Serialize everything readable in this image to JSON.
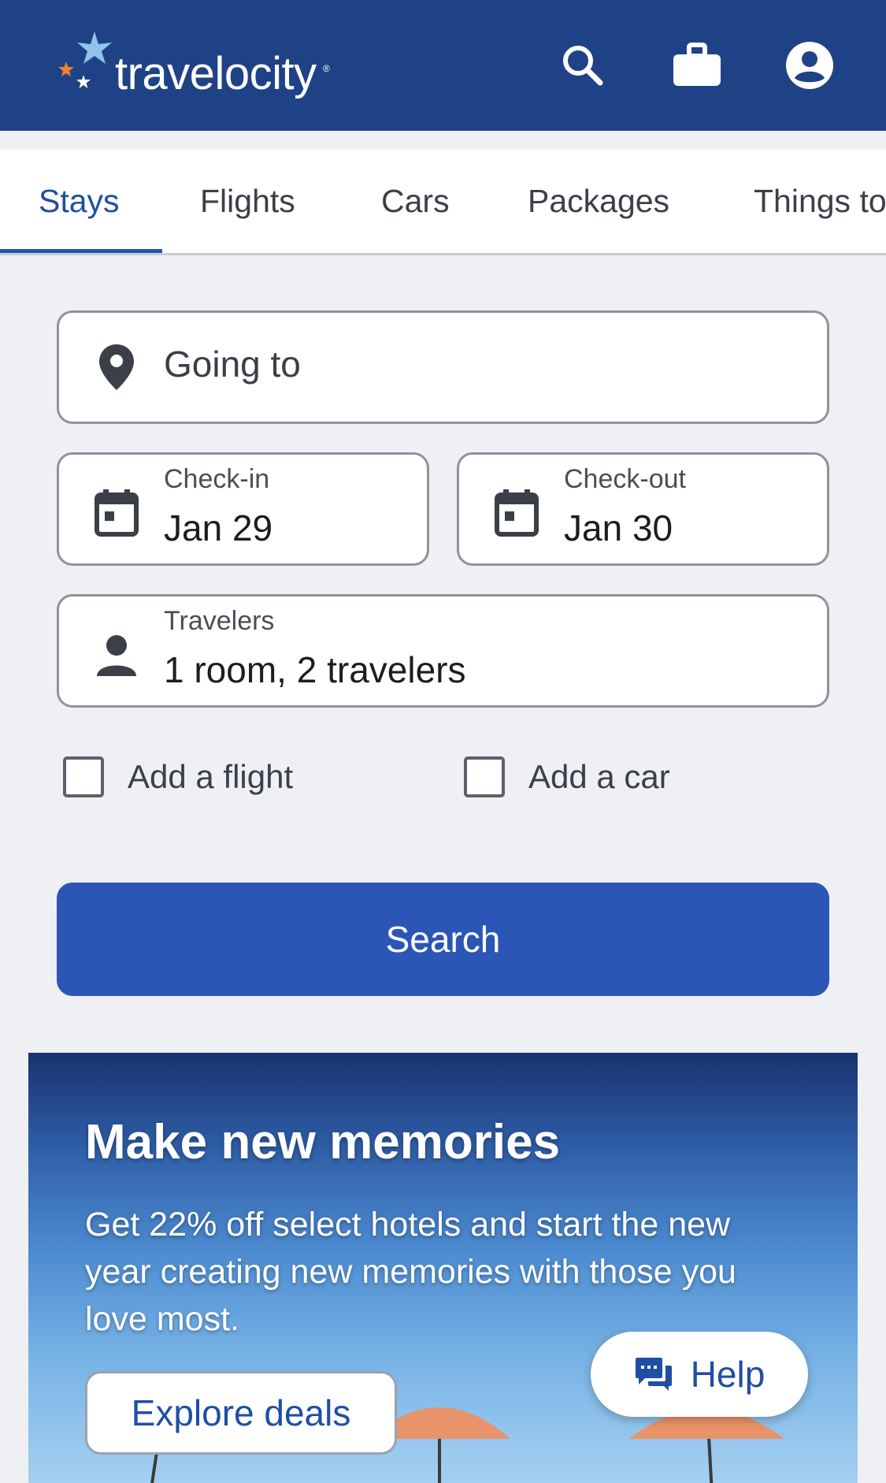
{
  "brand": {
    "name": "travelocity",
    "reg_mark": "®"
  },
  "header": {
    "icons": [
      "search-icon",
      "briefcase-icon",
      "account-icon"
    ]
  },
  "tabs": [
    {
      "label": "Stays",
      "active": true
    },
    {
      "label": "Flights",
      "active": false
    },
    {
      "label": "Cars",
      "active": false
    },
    {
      "label": "Packages",
      "active": false
    },
    {
      "label": "Things to do",
      "active": false
    }
  ],
  "form": {
    "destination": {
      "placeholder": "Going to",
      "icon": "map-pin-icon"
    },
    "checkin": {
      "label": "Check-in",
      "value": "Jan 29",
      "icon": "calendar-icon"
    },
    "checkout": {
      "label": "Check-out",
      "value": "Jan 30",
      "icon": "calendar-icon"
    },
    "travelers": {
      "label": "Travelers",
      "value": "1 room, 2 travelers",
      "icon": "person-icon"
    },
    "add_flight": {
      "label": "Add a flight",
      "checked": false
    },
    "add_car": {
      "label": "Add a car",
      "checked": false
    },
    "search_label": "Search"
  },
  "promo": {
    "title": "Make new memories",
    "body": "Get 22% off select hotels and start the new year creating new memories with those you love most.",
    "cta": "Explore deals"
  },
  "help": {
    "label": "Help",
    "icon": "chat-icon"
  },
  "colors": {
    "header_bg": "#1f4287",
    "accent": "#2b56b6",
    "active_tab": "#1f4ea3",
    "logo_orange": "#f0822e",
    "logo_light_blue": "#8fc3ea"
  }
}
